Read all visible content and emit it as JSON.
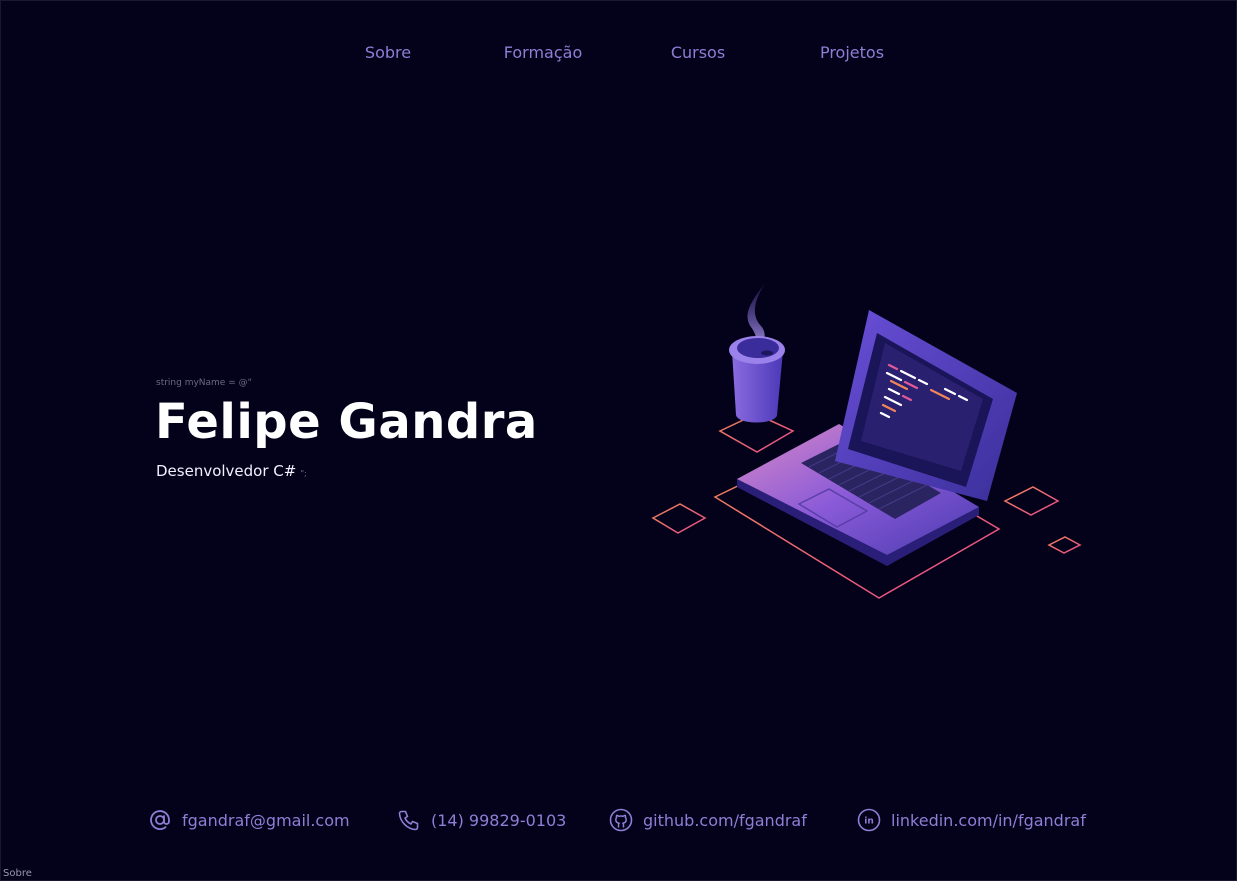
{
  "nav": {
    "items": [
      {
        "label": "Sobre"
      },
      {
        "label": "Formação"
      },
      {
        "label": "Cursos"
      },
      {
        "label": "Projetos"
      }
    ]
  },
  "hero": {
    "code_prefix": "string myName = @\"",
    "name": "Felipe Gandra",
    "role": "Desenvolvedor C#",
    "role_suffix": "\";"
  },
  "contacts": {
    "email": {
      "text": "fgandraf@gmail.com",
      "icon": "at-icon"
    },
    "phone": {
      "text": "(14) 99829-0103",
      "icon": "phone-icon"
    },
    "github": {
      "text": "github.com/fgandraf",
      "icon": "github-icon"
    },
    "linkedin": {
      "text": "linkedin.com/in/fgandraf",
      "icon": "linkedin-icon"
    }
  },
  "footer": {
    "label": "Sobre"
  },
  "colors": {
    "background": "#04021a",
    "accent": "#8f7ed6",
    "outline_gradient_start": "#f0845a",
    "outline_gradient_end": "#e64a8a"
  }
}
